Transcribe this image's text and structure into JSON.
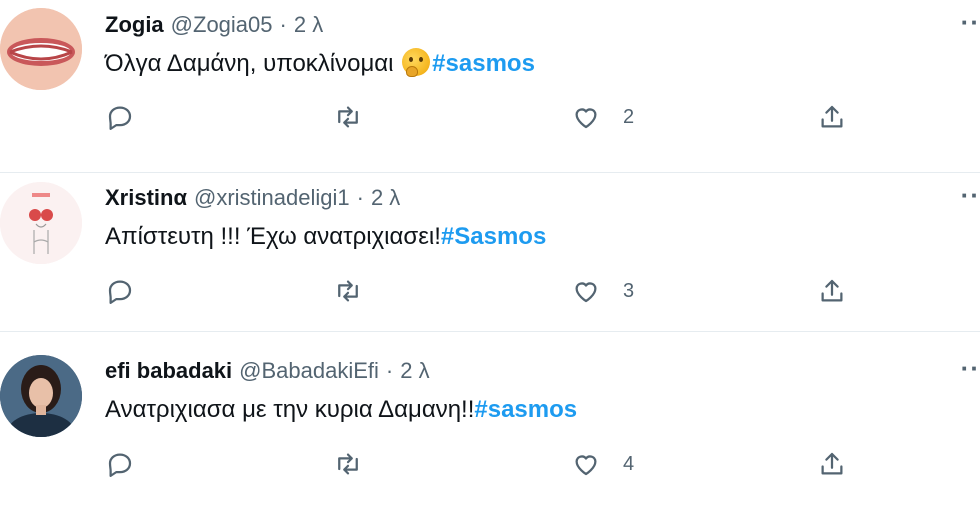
{
  "tweets": [
    {
      "name": "Zogia",
      "handle": "@Zogia05",
      "dot": "·",
      "time": "2 λ",
      "text": "Όλγα Δαμάνη, υποκλίνομαι ",
      "emoji": "thinking-face-emoji",
      "hashtag": "#sasmos",
      "likes": "2",
      "avatar": "smile-lips-avatar"
    },
    {
      "name": "Xristinα",
      "handle": "@xristinadeligi1",
      "dot": "·",
      "time": "2 λ",
      "text": "Απίστευτη !!! Έχω ανατριχιασει!",
      "hashtag": "#Sasmos",
      "likes": "3",
      "avatar": "illustration-avatar"
    },
    {
      "name": "efi babadaki",
      "handle": "@BabadakiEfi",
      "dot": "·",
      "time": "2 λ",
      "text": "Ανατριχιασα με την κυρια Δαμανη!!",
      "hashtag": "#sasmos",
      "likes": "4",
      "avatar": "woman-photo-avatar"
    }
  ],
  "icons": {
    "reply": "reply-icon",
    "retweet": "retweet-icon",
    "like": "like-icon",
    "share": "share-icon",
    "more": "more-icon"
  },
  "colors": {
    "hashtag": "#1d9bf0",
    "secondary_text": "#536471",
    "divider": "#e6ecf0"
  }
}
